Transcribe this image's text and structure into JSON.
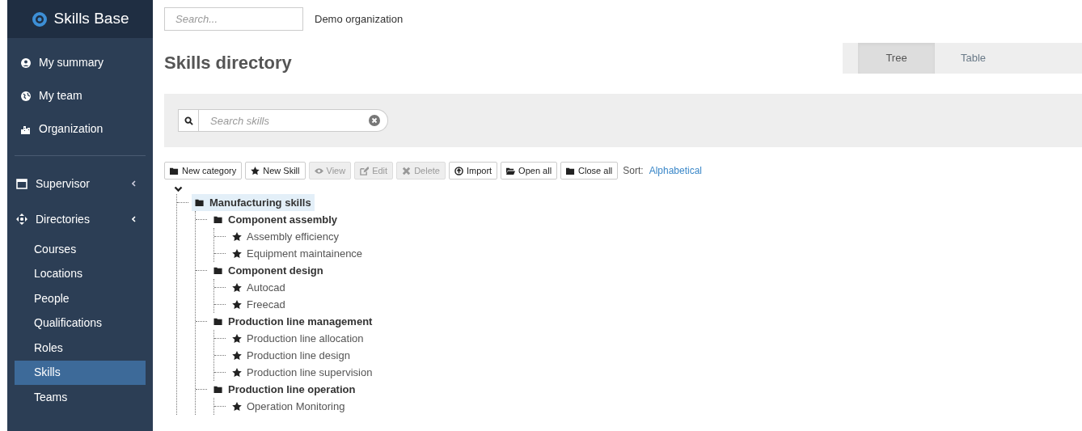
{
  "sidebar": {
    "brand": "Skills Base",
    "items": [
      {
        "label": "My summary",
        "selected": false
      },
      {
        "label": "My team",
        "selected": false
      },
      {
        "label": "Organization",
        "selected": false
      }
    ],
    "groups": [
      {
        "label": "Supervisor",
        "expanded": false
      },
      {
        "label": "Directories",
        "expanded": true,
        "children": [
          {
            "label": "Courses",
            "selected": false
          },
          {
            "label": "Locations",
            "selected": false
          },
          {
            "label": "People",
            "selected": false
          },
          {
            "label": "Qualifications",
            "selected": false
          },
          {
            "label": "Roles",
            "selected": false
          },
          {
            "label": "Skills",
            "selected": true
          },
          {
            "label": "Teams",
            "selected": false
          }
        ]
      }
    ]
  },
  "header": {
    "search": {
      "placeholder": "Search..."
    },
    "organization": "Demo organization"
  },
  "page_title": "Skills directory",
  "view_tabs": [
    {
      "label": "Tree",
      "selected": true
    },
    {
      "label": "Table",
      "selected": false
    }
  ],
  "skill_search": {
    "placeholder": "Search skills"
  },
  "toolbar": [
    {
      "label": "New category",
      "disabled": false
    },
    {
      "label": "New Skill",
      "disabled": false
    },
    {
      "label": "View",
      "disabled": true
    },
    {
      "label": "Edit",
      "disabled": true
    },
    {
      "label": "Delete",
      "disabled": true
    },
    {
      "label": "Import",
      "disabled": false
    },
    {
      "label": "Open all",
      "disabled": false
    },
    {
      "label": "Close all",
      "disabled": false
    }
  ],
  "sort": {
    "label": "Sort:",
    "value": "Alphabetical"
  },
  "tree": [
    {
      "kind": "category",
      "label": "Manufacturing skills",
      "selected": true,
      "children": [
        {
          "kind": "category",
          "label": "Component assembly",
          "selected": false,
          "children": [
            {
              "kind": "skill",
              "label": "Assembly efficiency",
              "selected": false
            },
            {
              "kind": "skill",
              "label": "Equipment maintainence",
              "selected": false
            }
          ]
        },
        {
          "kind": "category",
          "label": "Component design",
          "selected": false,
          "children": [
            {
              "kind": "skill",
              "label": "Autocad",
              "selected": false
            },
            {
              "kind": "skill",
              "label": "Freecad",
              "selected": false
            }
          ]
        },
        {
          "kind": "category",
          "label": "Production line management",
          "selected": false,
          "children": [
            {
              "kind": "skill",
              "label": "Production line allocation",
              "selected": false
            },
            {
              "kind": "skill",
              "label": "Production line design",
              "selected": false
            },
            {
              "kind": "skill",
              "label": "Production line supervision",
              "selected": false
            }
          ]
        },
        {
          "kind": "category",
          "label": "Production line operation",
          "selected": false,
          "children": [
            {
              "kind": "skill",
              "label": "Operation Monitoring",
              "selected": false
            }
          ]
        }
      ]
    }
  ]
}
